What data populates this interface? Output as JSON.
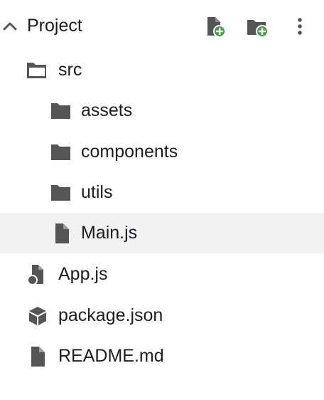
{
  "header": {
    "title": "Project",
    "chevron_icon": "chevron-up-icon",
    "new_file_icon": "new-file-icon",
    "new_folder_icon": "new-folder-icon",
    "more_icon": "more-vertical-icon",
    "accent_color": "#43a047",
    "icon_color": "#555555"
  },
  "tree": {
    "src": {
      "label": "src",
      "icon": "folder-open-icon"
    },
    "assets": {
      "label": "assets",
      "icon": "folder-icon"
    },
    "components": {
      "label": "components",
      "icon": "folder-icon"
    },
    "utils": {
      "label": "utils",
      "icon": "folder-icon"
    },
    "main_js": {
      "label": "Main.js",
      "icon": "file-icon",
      "selected": true
    },
    "app_js": {
      "label": "App.js",
      "icon": "file-shapes-icon"
    },
    "package_json": {
      "label": "package.json",
      "icon": "package-icon"
    },
    "readme": {
      "label": "README.md",
      "icon": "file-icon"
    }
  }
}
